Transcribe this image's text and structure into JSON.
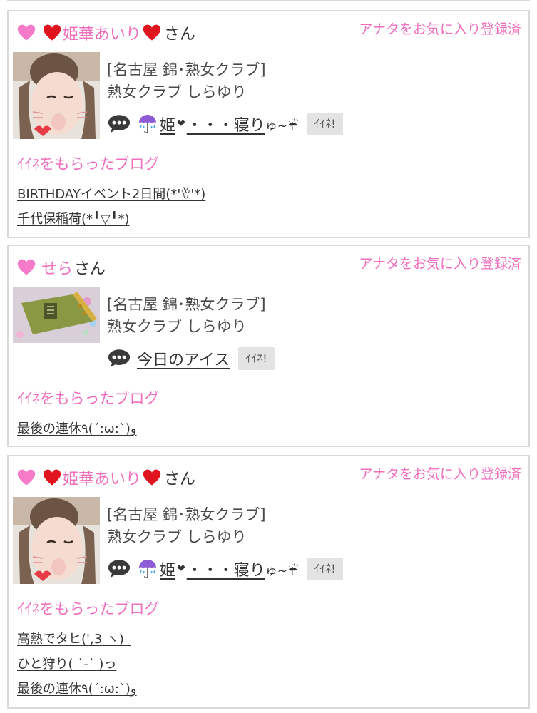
{
  "colors": {
    "accent_pink": "#f06fbd",
    "border": "#d9d9d9",
    "button_bg": "#e3e3e3"
  },
  "cards": [
    {
      "user_name": "姫華あいり",
      "honorific": "さん",
      "name_has_red_hearts": true,
      "fav_status": "アナタをお気に入り登録済",
      "shop_area": "[名古屋 錦･熟女クラブ]",
      "shop_name": "熟女クラブ しらゆり",
      "post_title_prefix": "姫",
      "post_title_mid": "・・・寝り",
      "post_title_suffix": "ゅ~☔",
      "iine_label": "ｲｲﾈ!",
      "liked_blogs_label": "ｲｲﾈをもらったブログ",
      "liked_blogs": [
        "BIRTHDAYイベント2日間(*'ꈊ'*)",
        "千代保稲荷(*╹▽╹*)"
      ]
    },
    {
      "user_name": "せら",
      "honorific": "さん",
      "name_has_red_hearts": false,
      "fav_status": "アナタをお気に入り登録済",
      "shop_area": "[名古屋 錦･熟女クラブ]",
      "shop_name": "熟女クラブ しらゆり",
      "post_title": "今日のアイス",
      "iine_label": "ｲｲﾈ!",
      "liked_blogs_label": "ｲｲﾈをもらったブログ",
      "liked_blogs": [
        "最後の連休٩(´:ω:`)و"
      ]
    },
    {
      "user_name": "姫華あいり",
      "honorific": "さん",
      "name_has_red_hearts": true,
      "fav_status": "アナタをお気に入り登録済",
      "shop_area": "[名古屋 錦･熟女クラブ]",
      "shop_name": "熟女クラブ しらゆり",
      "post_title_prefix": "姫",
      "post_title_mid": "・・・寝り",
      "post_title_suffix": "ゅ~☔",
      "iine_label": "ｲｲﾈ!",
      "liked_blogs_label": "ｲｲﾈをもらったブログ",
      "liked_blogs": [
        "高熱でタヒ(',3 ヽ)_",
        "ひと狩り( ˙-˙ )っ",
        "最後の連休٩(´:ω:`)و"
      ]
    }
  ]
}
